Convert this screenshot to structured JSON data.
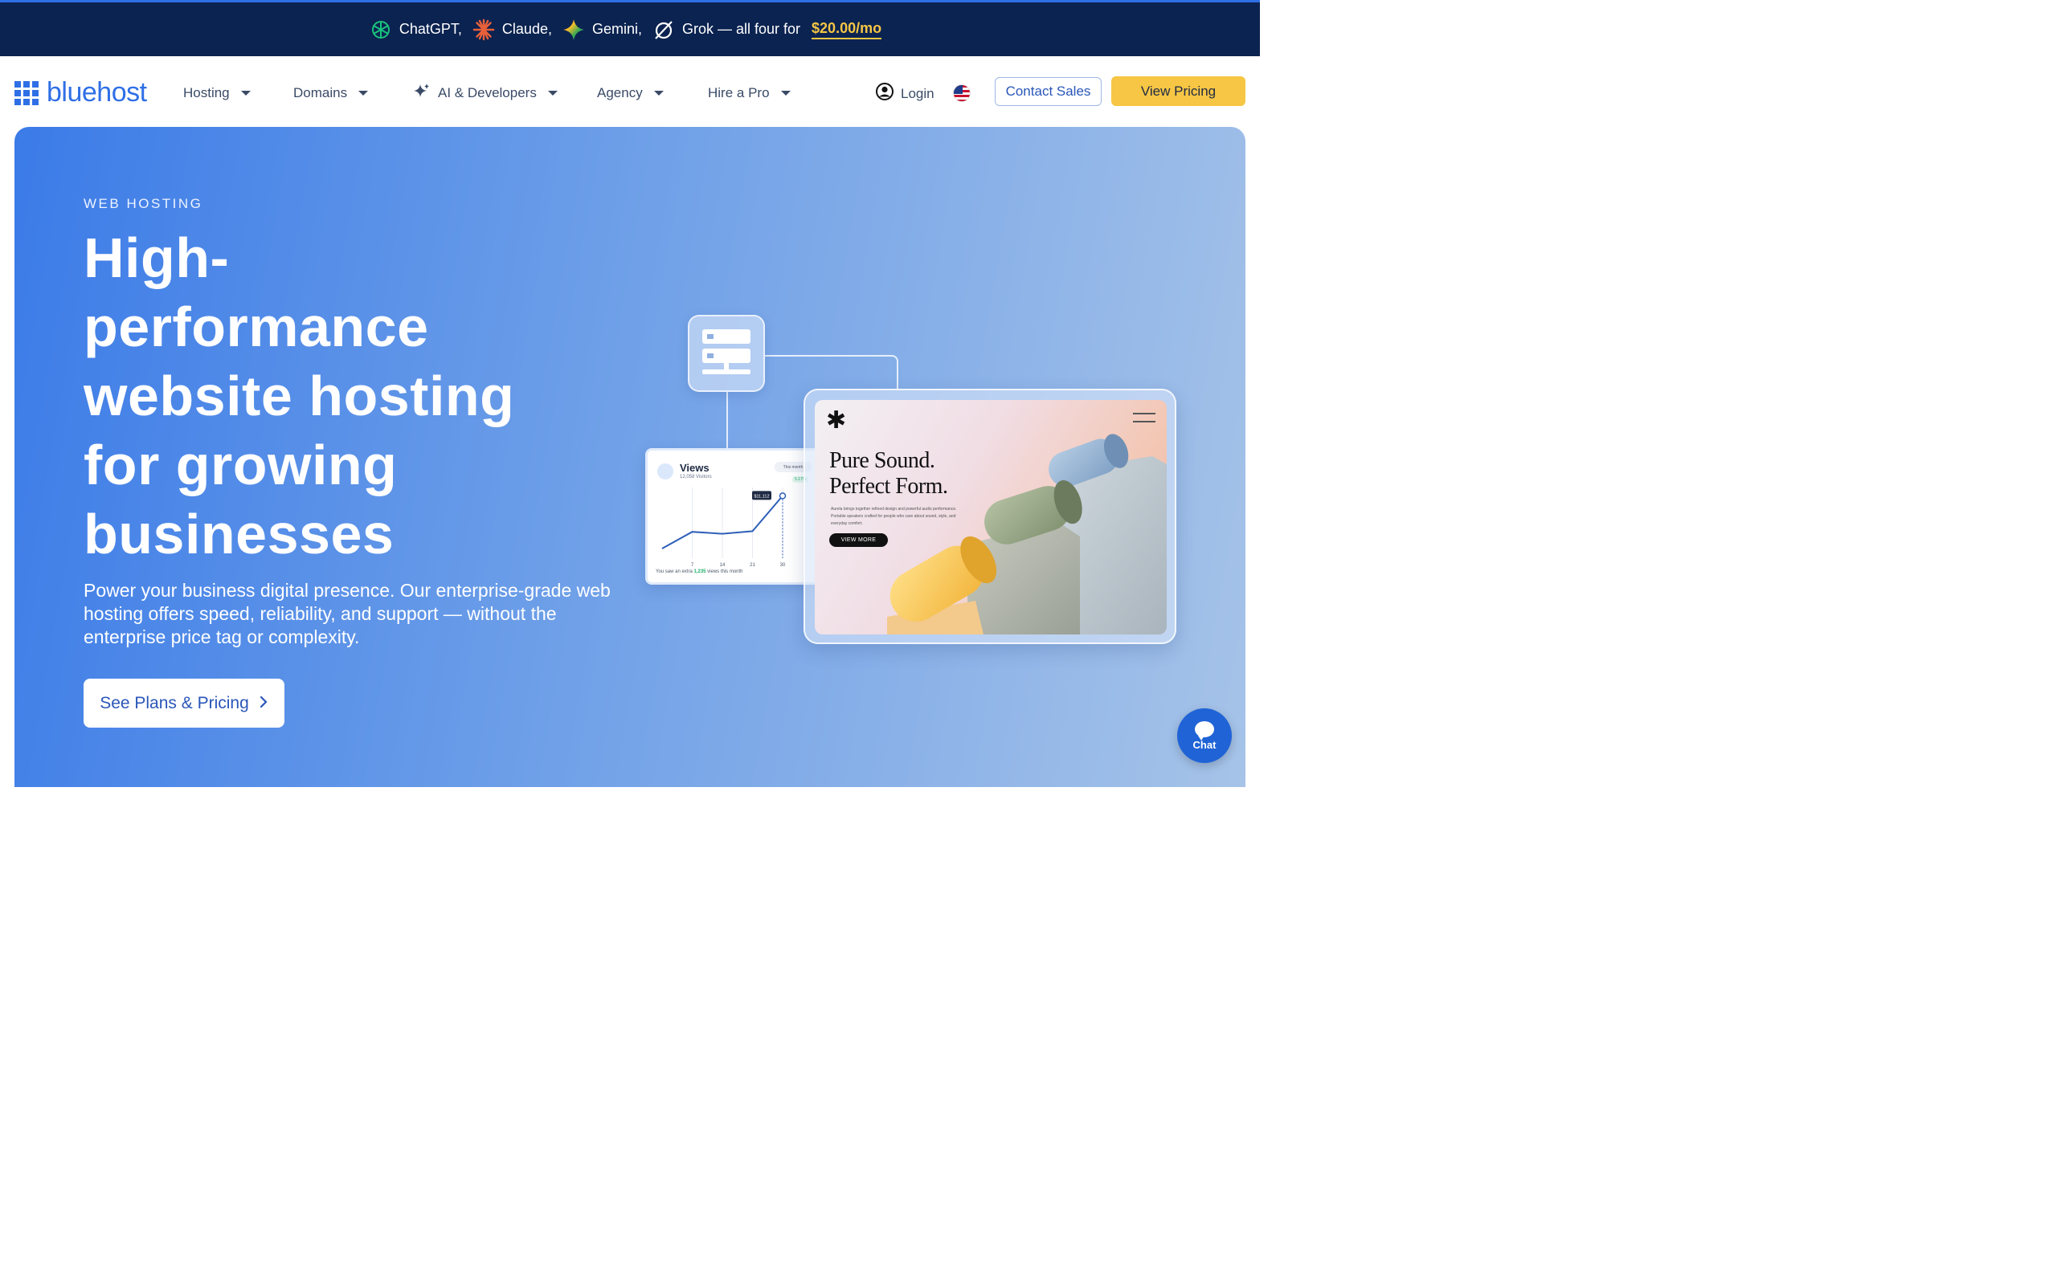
{
  "promo": {
    "items": [
      "ChatGPT,",
      "Claude,",
      "Gemini,",
      "Grok — all four for"
    ],
    "price": "$20.00/mo"
  },
  "brand": {
    "name": "bluehost",
    "color": "#2f6fe6"
  },
  "nav": {
    "items": [
      "Hosting",
      "Domains",
      "AI & Developers",
      "Agency",
      "Hire a Pro"
    ],
    "login": "Login",
    "contact_sales": "Contact Sales",
    "view_pricing": "View Pricing"
  },
  "hero": {
    "eyebrow": "WEB HOSTING",
    "headline": [
      "High-",
      "performance",
      "website hosting",
      "for growing",
      "businesses"
    ],
    "subtitle": "Power your business digital presence. Our enterprise-grade web hosting offers speed, reliability, and support — without the enterprise price tag or complexity.",
    "cta": "See Plans & Pricing"
  },
  "views_card": {
    "title": "Views",
    "subtitle": "12,058 Visitors",
    "range": "This month",
    "change": "5.17%",
    "tooltip": "$11,112",
    "ticks": [
      "7",
      "14",
      "21",
      "30"
    ],
    "footer_prefix": "You saw an extra",
    "footer_value": "1,235",
    "footer_suffix": "views this month",
    "series": [
      10,
      36,
      33,
      37,
      92
    ]
  },
  "site_preview": {
    "title_line1": "Pure Sound.",
    "title_line2": "Perfect Form.",
    "body": "Aurela brings together refined design and powerful audio performance. Portable speakers crafted for people who care about sound, style, and everyday comfort.",
    "button": "VIEW MORE"
  },
  "chat": {
    "label": "Chat"
  },
  "colors": {
    "accent": "#2f6fe6",
    "promo_bg": "#0b2350",
    "cta_yellow": "#f6c644"
  }
}
